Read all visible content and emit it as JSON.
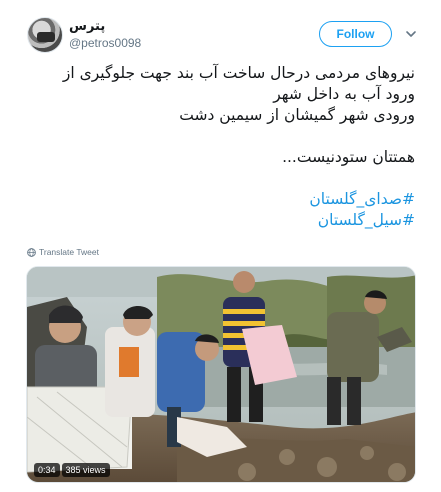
{
  "author": {
    "display_name": "پترس",
    "handle": "@petros0098"
  },
  "actions": {
    "follow_label": "Follow"
  },
  "icons": {
    "more": "chevron-down-icon",
    "translate": "globe-icon"
  },
  "tweet": {
    "lines": [
      "نیروهای مردمی درحال ساخت آب بند جهت جلوگیری از",
      "ورود آب به داخل شهر",
      "ورودی شهر گمیشان از سیمین دشت",
      "همتتان ستودنیست..."
    ],
    "hashtags": [
      "#صدای_گلستان",
      "#سیل_گلستان"
    ]
  },
  "translate_label": "Translate Tweet",
  "video": {
    "duration": "0:34",
    "views": "385 views"
  },
  "colors": {
    "accent": "#1da1f2",
    "hashtag": "#1b95e0",
    "secondary_text": "#657786"
  }
}
